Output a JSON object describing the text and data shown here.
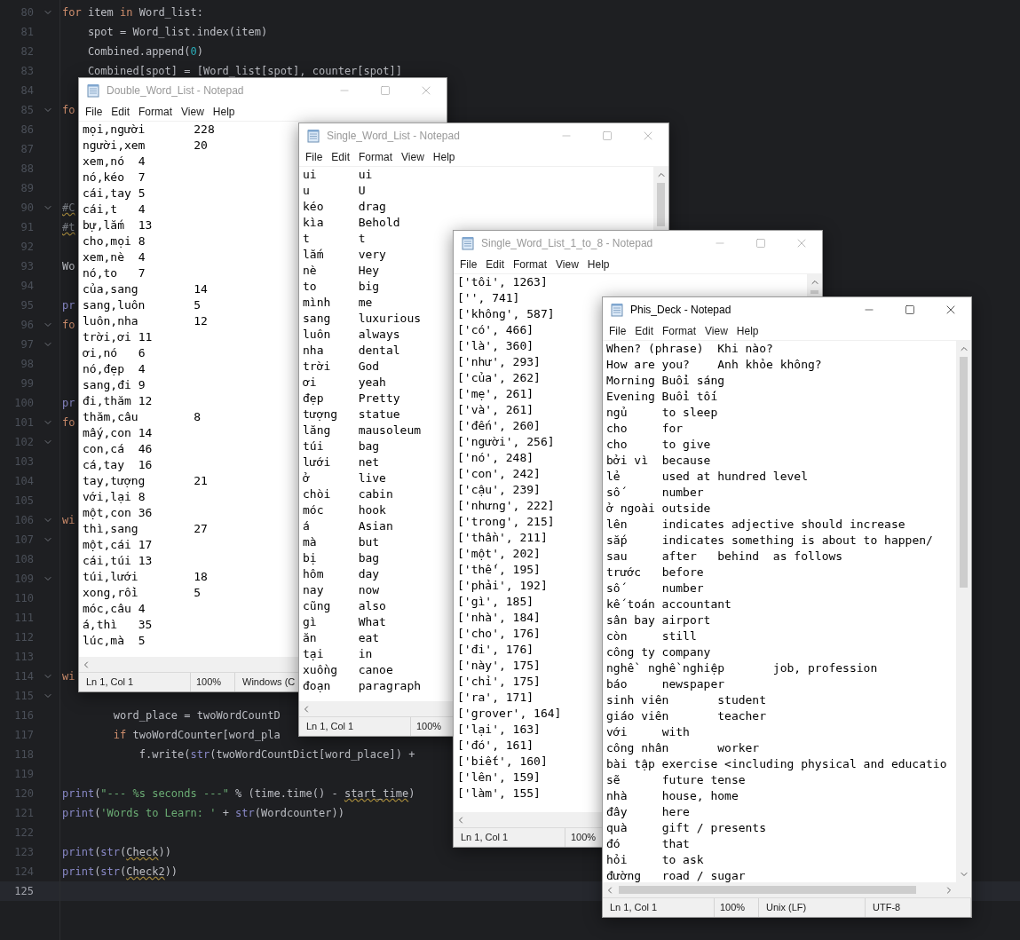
{
  "editor": {
    "lines": [
      {
        "number": "80",
        "fold": true,
        "current": false,
        "tokens": [
          {
            "text": "for",
            "kind": "keyword"
          },
          {
            "text": " item ",
            "kind": "plain"
          },
          {
            "text": "in",
            "kind": "keyword"
          },
          {
            "text": " Word_list:",
            "kind": "plain"
          }
        ]
      },
      {
        "number": "81",
        "fold": false,
        "current": false,
        "tokens": [
          {
            "text": "    spot = Word_list.index(item)",
            "kind": "plain"
          }
        ]
      },
      {
        "number": "82",
        "fold": false,
        "current": false,
        "tokens": [
          {
            "text": "    Combined.append(",
            "kind": "plain"
          },
          {
            "text": "0",
            "kind": "number"
          },
          {
            "text": ")",
            "kind": "plain"
          }
        ]
      },
      {
        "number": "83",
        "fold": false,
        "current": false,
        "tokens": [
          {
            "text": "    Combined[spot] = [Word_list[spot], counter[spot]]",
            "kind": "plain"
          }
        ]
      },
      {
        "number": "84",
        "fold": false,
        "current": false
      },
      {
        "number": "85",
        "fold": true,
        "current": false,
        "tokens": [
          {
            "text": "fo",
            "kind": "keyword"
          }
        ]
      },
      {
        "number": "86",
        "fold": false,
        "current": false
      },
      {
        "number": "87",
        "fold": false,
        "current": false
      },
      {
        "number": "88",
        "fold": false,
        "current": false
      },
      {
        "number": "89",
        "fold": false,
        "current": false
      },
      {
        "number": "90",
        "fold": true,
        "current": false,
        "tokens": [
          {
            "text": "#C",
            "kind": "comment-warning"
          }
        ]
      },
      {
        "number": "91",
        "fold": false,
        "current": false,
        "tokens": [
          {
            "text": "#t",
            "kind": "comment-warning"
          }
        ]
      },
      {
        "number": "92",
        "fold": false,
        "current": false
      },
      {
        "number": "93",
        "fold": false,
        "current": false,
        "tokens": [
          {
            "text": "Wo",
            "kind": "plain"
          }
        ]
      },
      {
        "number": "94",
        "fold": false,
        "current": false
      },
      {
        "number": "95",
        "fold": false,
        "current": false,
        "tokens": [
          {
            "text": "pr",
            "kind": "builtin"
          }
        ]
      },
      {
        "number": "96",
        "fold": true,
        "current": false,
        "tokens": [
          {
            "text": "fo",
            "kind": "keyword"
          }
        ]
      },
      {
        "number": "97",
        "fold": true,
        "current": false
      },
      {
        "number": "98",
        "fold": false,
        "current": false
      },
      {
        "number": "99",
        "fold": false,
        "current": false
      },
      {
        "number": "100",
        "fold": false,
        "current": false,
        "tokens": [
          {
            "text": "pr",
            "kind": "builtin"
          }
        ]
      },
      {
        "number": "101",
        "fold": true,
        "current": false,
        "tokens": [
          {
            "text": "fo",
            "kind": "keyword"
          }
        ]
      },
      {
        "number": "102",
        "fold": true,
        "current": false
      },
      {
        "number": "103",
        "fold": false,
        "current": false
      },
      {
        "number": "104",
        "fold": false,
        "current": false
      },
      {
        "number": "105",
        "fold": false,
        "current": false
      },
      {
        "number": "106",
        "fold": true,
        "current": false,
        "tokens": [
          {
            "text": "wi",
            "kind": "keyword"
          }
        ]
      },
      {
        "number": "107",
        "fold": true,
        "current": false
      },
      {
        "number": "108",
        "fold": false,
        "current": false
      },
      {
        "number": "109",
        "fold": true,
        "current": false
      },
      {
        "number": "110",
        "fold": false,
        "current": false
      },
      {
        "number": "111",
        "fold": false,
        "current": false
      },
      {
        "number": "112",
        "fold": false,
        "current": false
      },
      {
        "number": "113",
        "fold": false,
        "current": false
      },
      {
        "number": "114",
        "fold": true,
        "current": false,
        "tokens": [
          {
            "text": "wi",
            "kind": "keyword"
          }
        ]
      },
      {
        "number": "115",
        "fold": true,
        "current": false
      },
      {
        "number": "116",
        "fold": false,
        "current": false,
        "tokens": [
          {
            "text": "        word_place = twoWordCountD",
            "kind": "plain"
          }
        ]
      },
      {
        "number": "117",
        "fold": false,
        "current": false,
        "tokens": [
          {
            "text": "        if",
            "kind": "keyword"
          },
          {
            "text": " twoWordCounter[word_pla",
            "kind": "plain"
          }
        ]
      },
      {
        "number": "118",
        "fold": false,
        "current": false,
        "tokens": [
          {
            "text": "            f.write(",
            "kind": "plain"
          },
          {
            "text": "str",
            "kind": "builtin"
          },
          {
            "text": "(twoWordCountDict[word_place]) +",
            "kind": "plain"
          }
        ]
      },
      {
        "number": "119",
        "fold": false,
        "current": false
      },
      {
        "number": "120",
        "fold": false,
        "current": false,
        "tokens": [
          {
            "text": "print",
            "kind": "builtin"
          },
          {
            "text": "(",
            "kind": "plain"
          },
          {
            "text": "\"--- %s seconds ---\"",
            "kind": "string"
          },
          {
            "text": " % (time.time() - ",
            "kind": "plain"
          },
          {
            "text": "start_time",
            "kind": "warning"
          },
          {
            "text": ")",
            "kind": "plain"
          }
        ]
      },
      {
        "number": "121",
        "fold": false,
        "current": false,
        "tokens": [
          {
            "text": "print",
            "kind": "builtin"
          },
          {
            "text": "(",
            "kind": "plain"
          },
          {
            "text": "'Words to Learn: '",
            "kind": "string"
          },
          {
            "text": " + ",
            "kind": "plain"
          },
          {
            "text": "str",
            "kind": "builtin"
          },
          {
            "text": "(Wordcounter))",
            "kind": "plain"
          }
        ]
      },
      {
        "number": "122",
        "fold": false,
        "current": false
      },
      {
        "number": "123",
        "fold": false,
        "current": false,
        "tokens": [
          {
            "text": "print",
            "kind": "builtin"
          },
          {
            "text": "(",
            "kind": "plain"
          },
          {
            "text": "str",
            "kind": "builtin"
          },
          {
            "text": "(",
            "kind": "plain"
          },
          {
            "text": "Check",
            "kind": "warning"
          },
          {
            "text": "))",
            "kind": "plain"
          }
        ]
      },
      {
        "number": "124",
        "fold": false,
        "current": false,
        "tokens": [
          {
            "text": "print",
            "kind": "builtin"
          },
          {
            "text": "(",
            "kind": "plain"
          },
          {
            "text": "str",
            "kind": "builtin"
          },
          {
            "text": "(",
            "kind": "plain"
          },
          {
            "text": "Check2",
            "kind": "warning"
          },
          {
            "text": "))",
            "kind": "plain"
          }
        ]
      },
      {
        "number": "125",
        "fold": false,
        "current": true
      }
    ]
  },
  "windows": [
    {
      "title": "Double_Word_List - Notepad",
      "active": false,
      "menu": [
        "File",
        "Edit",
        "Format",
        "View",
        "Help"
      ],
      "lines": [
        "mọi,người\t228",
        "người,xem\t20",
        "xem,nó\t4",
        "nó,kéo\t7",
        "cái,tay\t5",
        "cái,t\t4",
        "bự,lắm\t13",
        "cho,mọi\t8",
        "xem,nè\t4",
        "nó,to\t7",
        "của,sang\t14",
        "sang,luôn\t5",
        "luôn,nha\t12",
        "trời,ơi\t11",
        "ơi,nó\t6",
        "nó,đẹp\t4",
        "sang,đi\t9",
        "đi,thăm\t12",
        "thăm,câu\t8",
        "mấy,con\t14",
        "con,cá\t46",
        "cá,tay\t16",
        "tay,tượng\t21",
        "với,lại\t8",
        "một,con\t36",
        "thì,sang\t27",
        "một,cái\t17",
        "cái,túi\t13",
        "túi,lưới\t18",
        "xong,rồi\t5",
        "móc,câu\t4",
        "á,thì\t35",
        "lúc,mà\t5"
      ],
      "status": [
        "Ln 1, Col 1",
        "100%",
        "Windows (C"
      ]
    },
    {
      "title": "Single_Word_List - Notepad",
      "active": false,
      "menu": [
        "File",
        "Edit",
        "Format",
        "View",
        "Help"
      ],
      "lines": [
        "ui\tui",
        "u\tU",
        "kéo\tdrag",
        "kìa\tBehold",
        "t\tt",
        "lắm\tvery",
        "nè\tHey",
        "to\tbig",
        "mình\tme",
        "sang\tluxurious",
        "luôn\talways",
        "nha\tdental",
        "trời\tGod",
        "ơi\tyeah",
        "đẹp\tPretty",
        "tượng\tstatue",
        "lăng\tmausoleum",
        "túi\tbag",
        "lưới\tnet",
        "ở\tlive",
        "chòi\tcabin",
        "móc\thook",
        "á\tAsian",
        "mà\tbut",
        "bị\tbag",
        "hôm\tday",
        "nay\tnow",
        "cũng\talso",
        "gì\tWhat",
        "ăn\teat",
        "tại\tin",
        "xuồng\tcanoe",
        "đoạn\tparagraph"
      ],
      "status": [
        "Ln 1, Col 1",
        "100%"
      ]
    },
    {
      "title": "Single_Word_List_1_to_8 - Notepad",
      "active": false,
      "menu": [
        "File",
        "Edit",
        "Format",
        "View",
        "Help"
      ],
      "lines": [
        "['tôi', 1263]",
        "['', 741]",
        "['không', 587]",
        "['có', 466]",
        "['là', 360]",
        "['như', 293]",
        "['của', 262]",
        "['mẹ', 261]",
        "['và', 261]",
        "['đến', 260]",
        "['người', 256]",
        "['nó', 248]",
        "['con', 242]",
        "['cậu', 239]",
        "['nhưng', 222]",
        "['trong', 215]",
        "['thần', 211]",
        "['một', 202]",
        "['thế', 195]",
        "['phải', 192]",
        "['gì', 185]",
        "['nhà', 184]",
        "['cho', 176]",
        "['đi', 176]",
        "['này', 175]",
        "['chỉ', 175]",
        "['ra', 171]",
        "['grover', 164]",
        "['lại', 163]",
        "['đó', 161]",
        "['biết', 160]",
        "['lên', 159]",
        "['làm', 155]"
      ],
      "status": [
        "Ln 1, Col 1",
        "100%"
      ]
    },
    {
      "title": "Phis_Deck - Notepad",
      "active": true,
      "menu": [
        "File",
        "Edit",
        "Format",
        "View",
        "Help"
      ],
      "lines": [
        "When? (phrase)\tKhi nào?",
        "How are you?\tAnh khỏe không?",
        "Morning Buổi sáng",
        "Evening Buổi tối",
        "ngủ\tto sleep",
        "cho\tfor",
        "cho\tto give",
        "bởi vì\tbecause",
        "lẻ\tused at hundred level",
        "số\tnumber",
        "ở ngoài outside",
        "lên\tindicates adjective should increase",
        "sắp\tindicates something is about to happen/",
        "sau\tafter\tbehind\tas follows",
        "trước\tbefore",
        "số\tnumber",
        "kế toán accountant",
        "sân bay airport",
        "còn\tstill",
        "công ty company",
        "nghề  nghề nghiệp       job, profession",
        "báo\tnewspaper",
        "sinh viên\tstudent",
        "giáo viên\tteacher",
        "với\twith",
        "công nhân\tworker",
        "bài tập exercise <including physical and educatio",
        "sẽ\tfuture tense",
        "nhà\thouse, home",
        "đây\there",
        "quà\tgift / presents",
        "đó\tthat",
        "hỏi\tto ask",
        "đường\troad / sugar"
      ],
      "status": [
        "Ln 1, Col 1",
        "100%",
        "Unix (LF)",
        "UTF-8"
      ]
    }
  ]
}
